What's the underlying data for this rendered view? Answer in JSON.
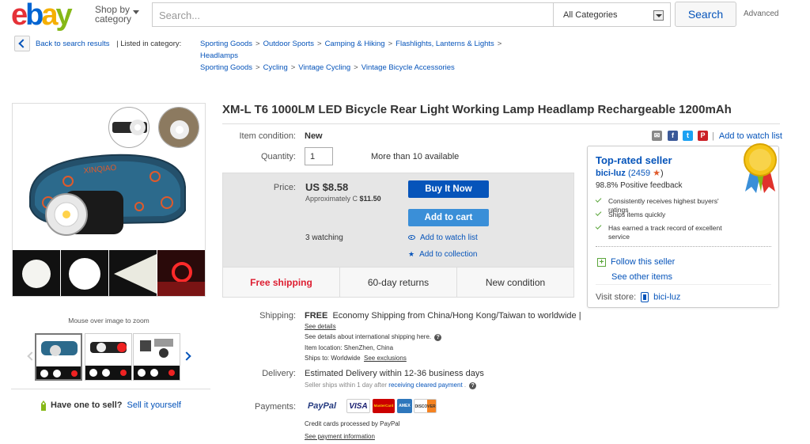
{
  "header": {
    "logo_letters": [
      "e",
      "b",
      "a",
      "y"
    ],
    "shop_by_line1": "Shop by",
    "shop_by_line2": "category",
    "search_placeholder": "Search...",
    "category_value": "All Categories",
    "search_button": "Search",
    "advanced": "Advanced"
  },
  "breadcrumb": {
    "back_label": "Back to search results",
    "listed_in": "| Listed in category:",
    "path1": [
      "Sporting Goods",
      "Outdoor Sports",
      "Camping & Hiking",
      "Flashlights, Lanterns & Lights"
    ],
    "path1_cont": "Headlamps",
    "path2": [
      "Sporting Goods",
      "Cycling",
      "Vintage Cycling",
      "Vintage Bicycle Accessories"
    ]
  },
  "gallery": {
    "zoom_hint": "Mouse over image to zoom",
    "main_image_brand": "XINQIAO"
  },
  "sell": {
    "prompt": "Have one to sell?",
    "link": "Sell it yourself"
  },
  "listing": {
    "title": "XM-L T6 1000LM LED Bicycle Rear Light Working Lamp Headlamp Rechargeable 1200mAh",
    "condition_label": "Item condition:",
    "condition_value": "New",
    "quantity_label": "Quantity:",
    "quantity_value": "1",
    "available": "More than 10 available",
    "price_label": "Price:",
    "price": "US $8.58",
    "approx_prefix": "Approximately C",
    "approx_value": "$11.50",
    "buy_now": "Buy It Now",
    "add_to_cart": "Add to cart",
    "watching": "3 watching",
    "add_watch": "Add to watch list",
    "add_collection": "Add to collection",
    "free_shipping": "Free shipping",
    "returns": "60-day returns",
    "new_condition": "New condition"
  },
  "share": {
    "icons": [
      "mail-icon",
      "facebook-icon",
      "twitter-icon",
      "pinterest-icon"
    ],
    "watchlist": "Add to watch list"
  },
  "seller": {
    "badge": "Top-rated seller",
    "name": "bici-luz",
    "score": "(2459",
    "positive": "98.8% Positive feedback",
    "features": [
      "Consistently receives highest buyers' ratings",
      "Ships items quickly",
      "Has earned a track record of excellent service"
    ],
    "follow": "Follow this seller",
    "see_other": "See other items",
    "visit_label": "Visit store:",
    "store_name": "bici-luz"
  },
  "shipping": {
    "label": "Shipping:",
    "free": "FREE",
    "detail": "Economy Shipping from China/Hong Kong/Taiwan to worldwide |",
    "see_details": "See details",
    "intl": "See details about international shipping here.",
    "location": "Item location:  ShenZhen, China",
    "ships_to_prefix": "Ships to:  Worldwide",
    "see_exclusions": "See exclusions"
  },
  "delivery": {
    "label": "Delivery:",
    "estimate": "Estimated Delivery within 12-36 business days",
    "note_prefix": "Seller ships within 1 day after",
    "note_link": "receiving cleared payment",
    "note_suffix": "."
  },
  "payments": {
    "label": "Payments:",
    "logos": [
      "PayPal",
      "VISA",
      "MasterCard",
      "AMEX",
      "DISCOVER"
    ],
    "processed": "Credit cards processed by PayPal",
    "info": "See payment information"
  },
  "colors": {
    "link": "#0654ba",
    "buy_btn": "#0654ba",
    "cart_btn": "#3a8fd8",
    "free_shipping": "#dd1e31"
  }
}
